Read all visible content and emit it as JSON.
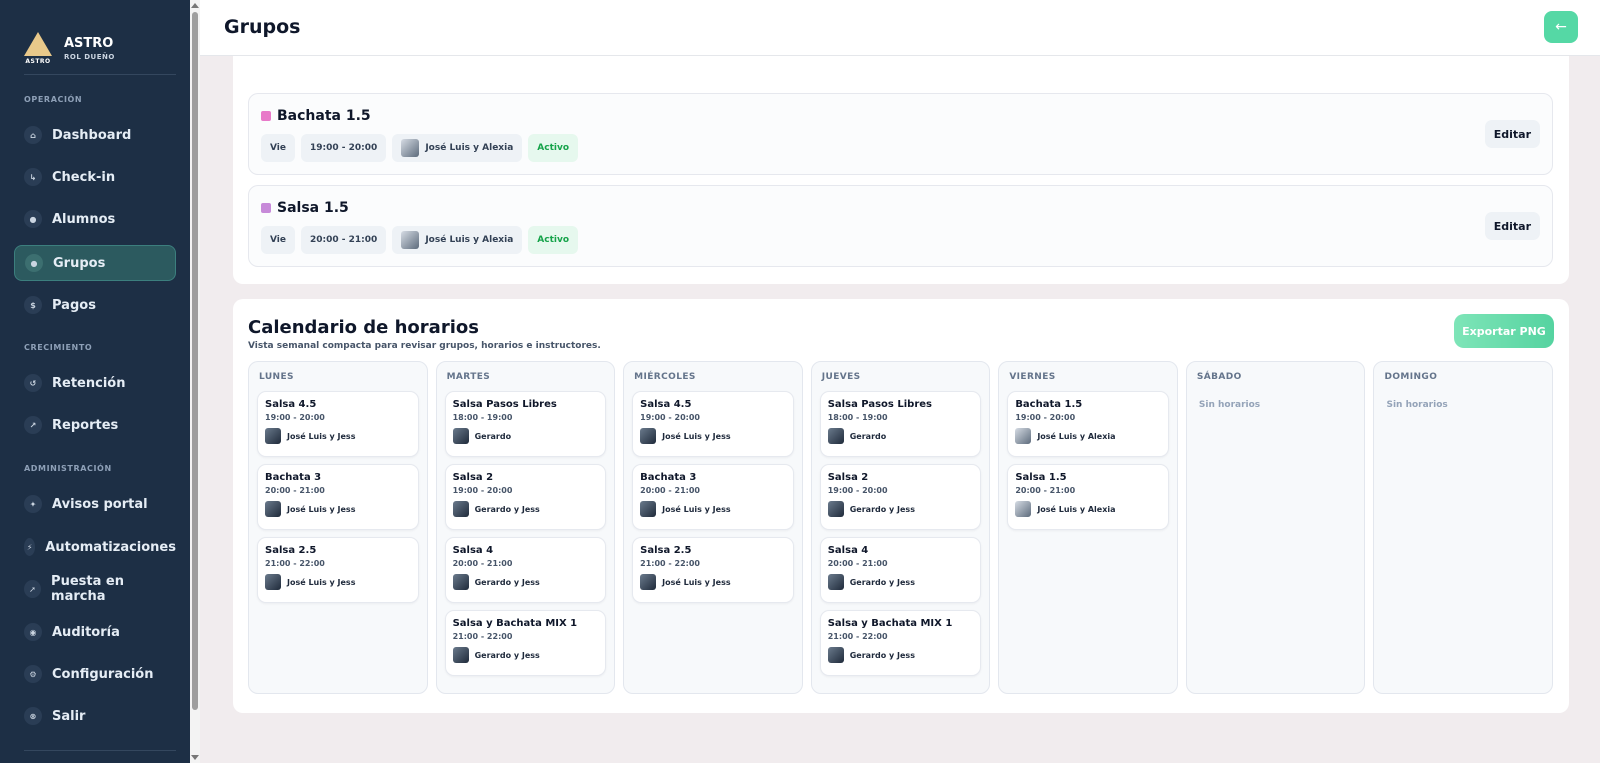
{
  "brand": {
    "name": "ASTRO",
    "logo_text": "ASTRO",
    "role": "ROL DUEÑO"
  },
  "sidebar": {
    "sections": [
      "OPERACIÓN",
      "CRECIMIENTO",
      "ADMINISTRACIÓN"
    ],
    "items": [
      {
        "label": "Dashboard",
        "icon": "home-icon",
        "glyph": "⌂"
      },
      {
        "label": "Check-in",
        "icon": "checkin-icon",
        "glyph": "↳"
      },
      {
        "label": "Alumnos",
        "icon": "users-icon",
        "glyph": "●"
      },
      {
        "label": "Grupos",
        "icon": "groups-icon",
        "glyph": "●"
      },
      {
        "label": "Pagos",
        "icon": "dollar-icon",
        "glyph": "$"
      },
      {
        "label": "Retención",
        "icon": "refresh-icon",
        "glyph": "↺"
      },
      {
        "label": "Reportes",
        "icon": "chart-icon",
        "glyph": "↗"
      },
      {
        "label": "Avisos portal",
        "icon": "sparkle-icon",
        "glyph": "✦"
      },
      {
        "label": "Automatizaciones",
        "icon": "bolt-icon",
        "glyph": "⚡"
      },
      {
        "label": "Puesta en marcha",
        "icon": "rocket-icon",
        "glyph": "➚"
      },
      {
        "label": "Auditoría",
        "icon": "eye-icon",
        "glyph": "◉"
      },
      {
        "label": "Configuración",
        "icon": "gear-icon",
        "glyph": "⚙"
      },
      {
        "label": "Salir",
        "icon": "logout-icon",
        "glyph": "⊗"
      }
    ]
  },
  "header": {
    "title": "Grupos",
    "back_glyph": "←"
  },
  "groups": [
    {
      "name": "Bachata 1.5",
      "color": "#e879c9",
      "day": "Vie",
      "time": "19:00 - 20:00",
      "instructor": "José Luis y Alexia",
      "status": "Activo",
      "edit_label": "Editar"
    },
    {
      "name": "Salsa 1.5",
      "color": "#c78ad9",
      "day": "Vie",
      "time": "20:00 - 21:00",
      "instructor": "José Luis y Alexia",
      "status": "Activo",
      "edit_label": "Editar"
    }
  ],
  "calendar": {
    "title": "Calendario de horarios",
    "subtitle": "Vista semanal compacta para revisar grupos, horarios e instructores.",
    "export_label": "Exportar PNG",
    "empty_label": "Sin horarios",
    "days": [
      {
        "name": "LUNES",
        "classes": [
          {
            "name": "Salsa 4.5",
            "time": "19:00 - 20:00",
            "instructor": "José Luis y Jess"
          },
          {
            "name": "Bachata 3",
            "time": "20:00 - 21:00",
            "instructor": "José Luis y Jess"
          },
          {
            "name": "Salsa 2.5",
            "time": "21:00 - 22:00",
            "instructor": "José Luis y Jess"
          }
        ]
      },
      {
        "name": "MARTES",
        "classes": [
          {
            "name": "Salsa Pasos Libres",
            "time": "18:00 - 19:00",
            "instructor": "Gerardo"
          },
          {
            "name": "Salsa 2",
            "time": "19:00 - 20:00",
            "instructor": "Gerardo y Jess"
          },
          {
            "name": "Salsa 4",
            "time": "20:00 - 21:00",
            "instructor": "Gerardo y Jess"
          },
          {
            "name": "Salsa y Bachata MIX 1",
            "time": "21:00 - 22:00",
            "instructor": "Gerardo y Jess"
          }
        ]
      },
      {
        "name": "MIÉRCOLES",
        "classes": [
          {
            "name": "Salsa 4.5",
            "time": "19:00 - 20:00",
            "instructor": "José Luis y Jess"
          },
          {
            "name": "Bachata 3",
            "time": "20:00 - 21:00",
            "instructor": "José Luis y Jess"
          },
          {
            "name": "Salsa 2.5",
            "time": "21:00 - 22:00",
            "instructor": "José Luis y Jess"
          }
        ]
      },
      {
        "name": "JUEVES",
        "classes": [
          {
            "name": "Salsa Pasos Libres",
            "time": "18:00 - 19:00",
            "instructor": "Gerardo"
          },
          {
            "name": "Salsa 2",
            "time": "19:00 - 20:00",
            "instructor": "Gerardo y Jess"
          },
          {
            "name": "Salsa 4",
            "time": "20:00 - 21:00",
            "instructor": "Gerardo y Jess"
          },
          {
            "name": "Salsa y Bachata MIX 1",
            "time": "21:00 - 22:00",
            "instructor": "Gerardo y Jess"
          }
        ]
      },
      {
        "name": "VIERNES",
        "classes": [
          {
            "name": "Bachata 1.5",
            "time": "19:00 - 20:00",
            "instructor": "José Luis y Alexia"
          },
          {
            "name": "Salsa 1.5",
            "time": "20:00 - 21:00",
            "instructor": "José Luis y Alexia"
          }
        ]
      },
      {
        "name": "SÁBADO",
        "classes": []
      },
      {
        "name": "DOMINGO",
        "classes": []
      }
    ]
  }
}
